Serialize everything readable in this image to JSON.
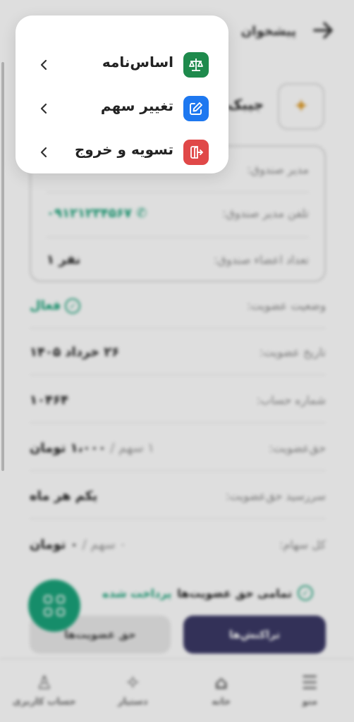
{
  "header": {
    "title": "پیشخوان"
  },
  "fund": {
    "name": "جیبک"
  },
  "info_card": {
    "manager": {
      "label": "مدیر صندوق:"
    },
    "manager_phone": {
      "label": "تلفن مدیر صندوق:",
      "value": "۰۹۱۲۱۲۳۴۵۶۷"
    },
    "members_count": {
      "label": "تعداد اعضاء صندوق:",
      "value": "۱ نفر"
    }
  },
  "details": [
    {
      "label": "وضعیت عضویت:",
      "value": "فعال"
    },
    {
      "label": "تاریخ عضویت:",
      "value": "۲۶ خرداد ۱۴۰۵"
    },
    {
      "label": "شماره حساب:",
      "value": "۱۰۴۶۴"
    },
    {
      "label": "حق‌عضویت:",
      "muted": "۱ سهم /",
      "value": "۱،۰۰۰ تومان"
    },
    {
      "label": "سررسید حق‌عضویت:",
      "value": "یکم هر ماه"
    },
    {
      "label": "کل سهام:",
      "muted": "۰ سهم /",
      "value": "۰ تومان"
    }
  ],
  "paid_notice": {
    "text": "تمامی حق عضویت‌ها",
    "status": "پرداخت شده"
  },
  "buttons": {
    "transactions": "تراکنش‌ها",
    "membership_fees": "حق عضویت‌ها"
  },
  "bottom_nav": [
    {
      "label": "منو",
      "icon": "menu-icon"
    },
    {
      "label": "خانه",
      "icon": "home-icon"
    },
    {
      "label": "دستیار",
      "icon": "sparkle-icon"
    },
    {
      "label": "حساب کاربری",
      "icon": "user-icon"
    }
  ],
  "menu": {
    "items": [
      {
        "label": "اساس‌نامه",
        "icon": "scales-icon",
        "color": "#1e8a4c"
      },
      {
        "label": "تغییر سهم",
        "icon": "edit-icon",
        "color": "#1e78f0"
      },
      {
        "label": "تسویه و خروج",
        "icon": "exit-icon",
        "color": "#e04848"
      }
    ]
  },
  "colors": {
    "accent_green": "#1aa37a",
    "primary_button": "#3b3966"
  }
}
